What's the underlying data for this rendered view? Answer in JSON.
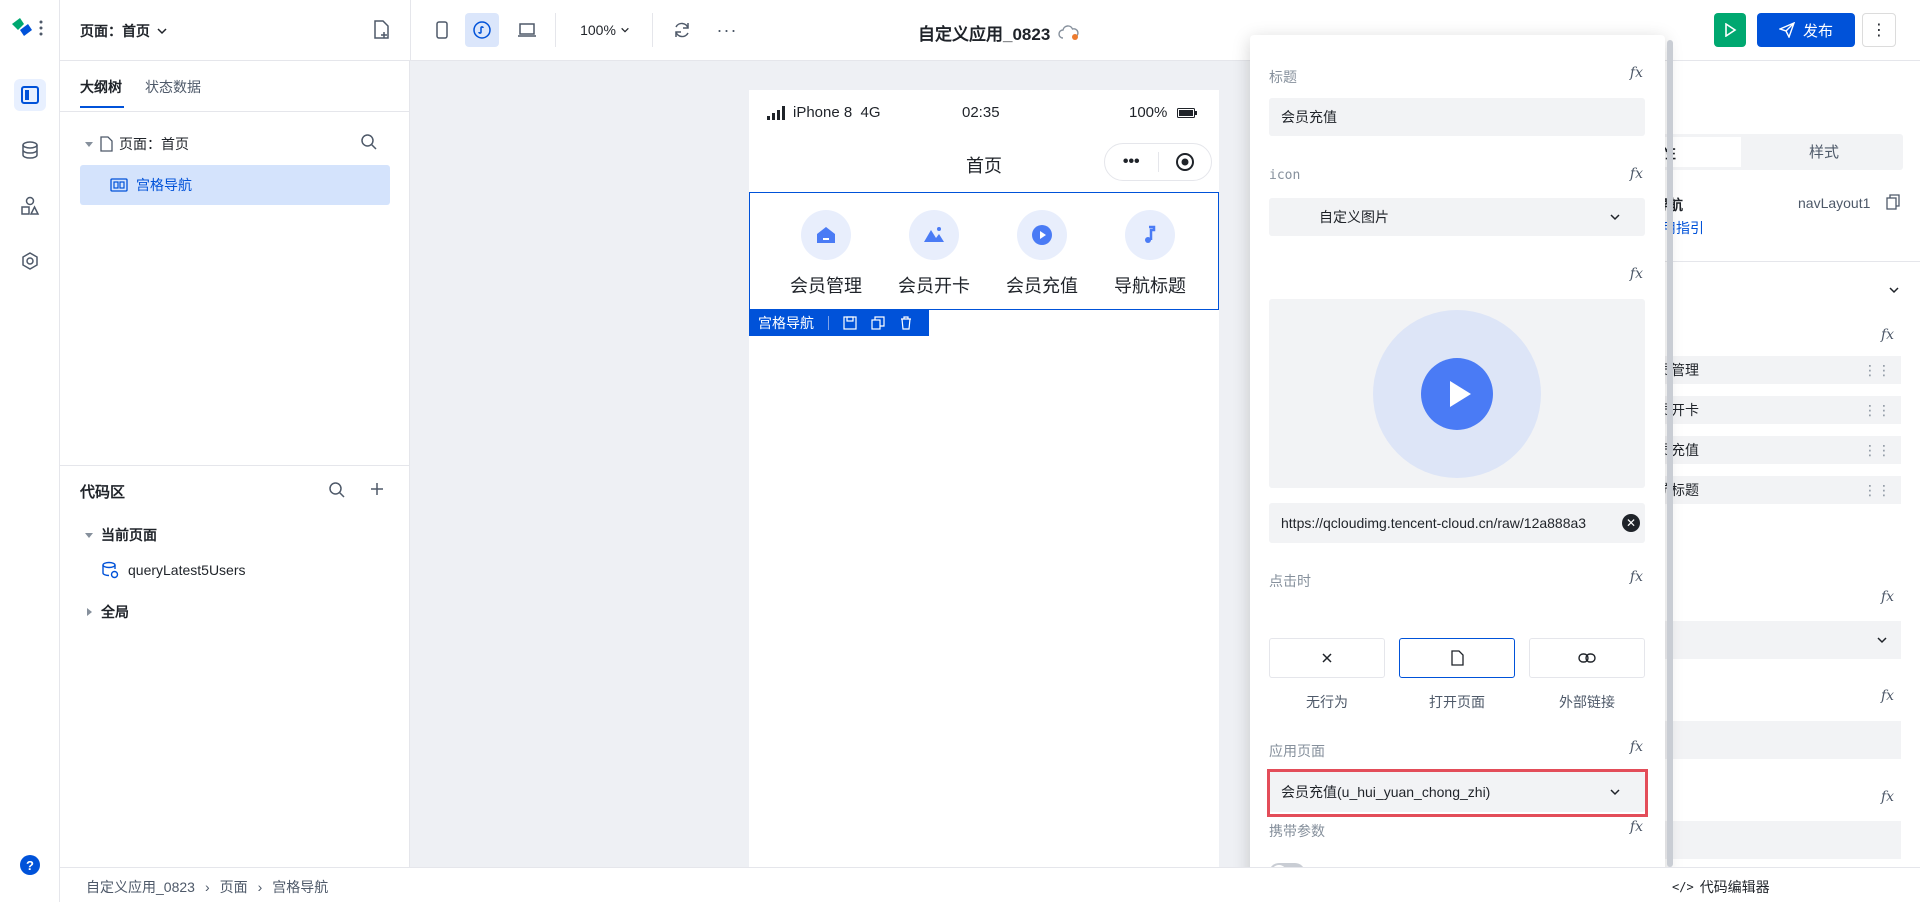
{
  "topbar": {
    "page_selector": "页面：首页",
    "zoom": "100%",
    "app_title": "自定义应用_0823",
    "publish_label": "发布"
  },
  "left_panel": {
    "tabs": [
      "大纲树",
      "状态数据"
    ],
    "tree_root": "页面：首页",
    "tree_child": "宫格导航",
    "code_area_title": "代码区",
    "current_page": "当前页面",
    "query_name": "queryLatest5Users",
    "global": "全局"
  },
  "phone": {
    "carrier": "iPhone 8  4G",
    "time": "02:35",
    "battery": "100%",
    "nav_title": "首页",
    "nav_items": [
      "会员管理",
      "会员开卡",
      "会员充值",
      "导航标题"
    ],
    "component_tag": "宫格导航"
  },
  "popover": {
    "title_label": "标题",
    "title_value": "会员充值",
    "icon_label": "icon",
    "icon_value": "自定义图片",
    "image_url": "https://qcloudimg.tencent-cloud.cn/raw/12a888a3",
    "on_click_label": "点击时",
    "actions": [
      "无行为",
      "打开页面",
      "外部链接"
    ],
    "app_page_label": "应用页面",
    "app_page_value": "会员充值(u_hui_yuan_chong_zhi)",
    "params_label": "携带参数",
    "fx": "fx"
  },
  "right_panel": {
    "tab_attr": "性",
    "tab_style": "样式",
    "component_name": "格导航",
    "component_id": "navLayout1",
    "guide_link": "使用指引",
    "items": [
      "会员管理",
      "会员开卡",
      "会员充值",
      "导航标题"
    ]
  },
  "bottombar": {
    "crumbs": [
      "自定义应用_0823",
      "页面",
      "宫格导航"
    ],
    "right_text": "代码编辑器"
  },
  "colors": {
    "primary": "#0052d9",
    "run_green": "#00a870",
    "highlight_red": "#e34d59"
  }
}
